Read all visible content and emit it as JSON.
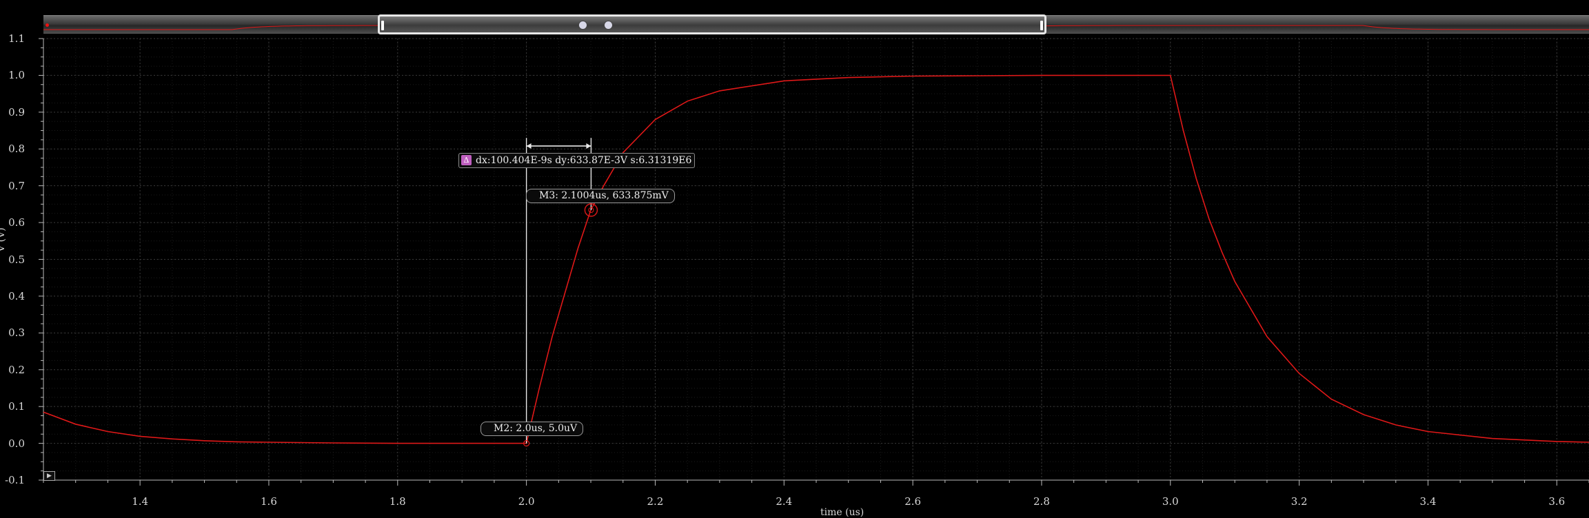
{
  "window": {
    "title": ""
  },
  "axes": {
    "x_label": "time (us)",
    "y_label": "V (V)",
    "x_ticks": [
      "1.4",
      "1.6",
      "1.8",
      "2.0",
      "2.2",
      "2.4",
      "2.6",
      "2.8",
      "3.0",
      "3.2",
      "3.4",
      "3.6"
    ],
    "y_ticks": [
      "1.1",
      "1.0",
      "0.9",
      "0.8",
      "0.7",
      "0.6",
      "0.5",
      "0.4",
      "0.3",
      "0.2",
      "0.1",
      "0.0",
      "-0.1"
    ]
  },
  "markers": {
    "m2": {
      "label": "M2: 2.0us, 5.0uV",
      "x": 2.0,
      "y": 5e-06
    },
    "m3": {
      "label": "M3: 2.1004us, 633.875mV",
      "x": 2.1004,
      "y": 0.633875
    },
    "delta": {
      "icon": "Δ",
      "label": "dx:100.404E-9s dy:633.87E-3V s:6.31319E6"
    }
  },
  "colors": {
    "trace": "#e01818",
    "grid": "#3a3a3a",
    "background": "#000000"
  },
  "controls": {
    "play_icon": "▶"
  },
  "chart_data": {
    "type": "line",
    "xlabel": "time (us)",
    "ylabel": "V (V)",
    "xlim": [
      1.25,
      3.65
    ],
    "ylim": [
      -0.1,
      1.1
    ],
    "grid": true,
    "series": [
      {
        "x": [
          1.25,
          1.3,
          1.35,
          1.4,
          1.45,
          1.5,
          1.55,
          1.6,
          1.7,
          1.8,
          1.9,
          2.0,
          2.02,
          2.04,
          2.06,
          2.08,
          2.1,
          2.12,
          2.15,
          2.2,
          2.25,
          2.3,
          2.4,
          2.5,
          2.6,
          2.7,
          2.8,
          2.9,
          3.0,
          3.02,
          3.04,
          3.06,
          3.08,
          3.1,
          3.15,
          3.2,
          3.25,
          3.3,
          3.35,
          3.4,
          3.5,
          3.6,
          3.65
        ],
        "y": [
          0.085,
          0.052,
          0.032,
          0.019,
          0.012,
          0.007,
          0.004,
          0.003,
          0.001,
          0.0,
          0.0,
          0.0,
          0.15,
          0.29,
          0.41,
          0.53,
          0.634,
          0.7,
          0.79,
          0.88,
          0.93,
          0.958,
          0.985,
          0.994,
          0.998,
          0.999,
          1.0,
          1.0,
          1.0,
          0.85,
          0.72,
          0.61,
          0.52,
          0.44,
          0.29,
          0.19,
          0.12,
          0.078,
          0.05,
          0.032,
          0.013,
          0.005,
          0.003
        ]
      }
    ]
  }
}
